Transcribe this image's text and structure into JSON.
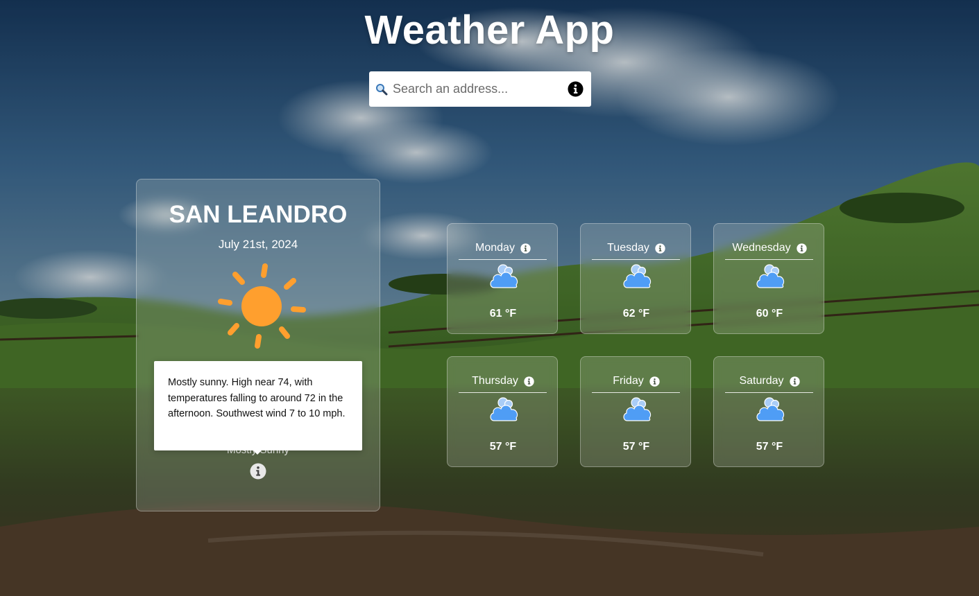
{
  "app": {
    "title": "Weather App"
  },
  "search": {
    "placeholder": "Search an address...",
    "value": ""
  },
  "current": {
    "city": "SAN LEANDRO",
    "date": "July 21st, 2024",
    "condition": "Mostly Sunny",
    "icon": "sun-icon",
    "tooltip": "Mostly sunny. High near 74, with temperatures falling to around 72 in the afternoon. Southwest wind 7 to 10 mph."
  },
  "forecast": [
    {
      "day": "Monday",
      "temp": "61 °F",
      "icon": "partly-cloudy-icon"
    },
    {
      "day": "Tuesday",
      "temp": "62 °F",
      "icon": "partly-cloudy-icon"
    },
    {
      "day": "Wednesday",
      "temp": "60 °F",
      "icon": "partly-cloudy-icon"
    },
    {
      "day": "Thursday",
      "temp": "57 °F",
      "icon": "partly-cloudy-icon"
    },
    {
      "day": "Friday",
      "temp": "57 °F",
      "icon": "partly-cloudy-icon"
    },
    {
      "day": "Saturday",
      "temp": "57 °F",
      "icon": "partly-cloudy-icon"
    }
  ],
  "colors": {
    "sun": "#ff9f2e",
    "cloud": "#4f9df5",
    "cloud_back": "#a9cdf7"
  }
}
